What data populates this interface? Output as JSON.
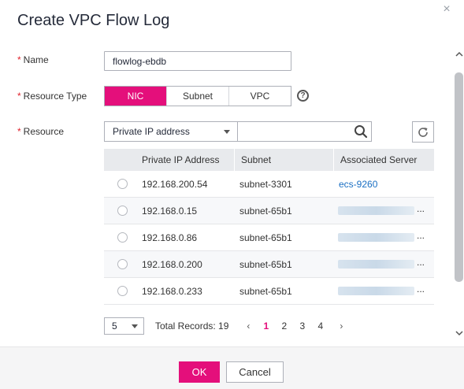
{
  "dialog": {
    "title": "Create VPC Flow Log",
    "close_symbol": "×"
  },
  "form": {
    "name_label": "Name",
    "name_value": "flowlog-ebdb",
    "resource_type_label": "Resource Type",
    "resource_types": [
      "NIC",
      "Subnet",
      "VPC"
    ],
    "resource_type_selected": "NIC",
    "resource_label": "Resource",
    "required_marker": "*",
    "help_symbol": "?"
  },
  "filter": {
    "select_value": "Private IP address",
    "search_value": ""
  },
  "table": {
    "headers": [
      "Private IP Address",
      "Subnet",
      "Associated Server"
    ],
    "rows": [
      {
        "ip": "192.168.200.54",
        "subnet": "subnet-3301",
        "server": "ecs-9260",
        "ellipsis": ""
      },
      {
        "ip": "192.168.0.15",
        "subnet": "subnet-65b1",
        "server": "",
        "ellipsis": "..."
      },
      {
        "ip": "192.168.0.86",
        "subnet": "subnet-65b1",
        "server": "",
        "ellipsis": "..."
      },
      {
        "ip": "192.168.0.200",
        "subnet": "subnet-65b1",
        "server": "",
        "ellipsis": "..."
      },
      {
        "ip": "192.168.0.233",
        "subnet": "subnet-65b1",
        "server": "",
        "ellipsis": "..."
      }
    ]
  },
  "pager": {
    "page_size": "5",
    "total_label": "Total Records: 19",
    "pages": [
      "1",
      "2",
      "3",
      "4"
    ],
    "current_page": "1",
    "prev_symbol": "‹",
    "next_symbol": "›"
  },
  "footer": {
    "ok_label": "OK",
    "cancel_label": "Cancel"
  },
  "colors": {
    "accent": "#e40f7b",
    "link": "#1a6fc3",
    "required": "#e0232d"
  },
  "icons": [
    "close-icon",
    "help-icon",
    "search-icon",
    "refresh-icon",
    "chevron-down-icon",
    "chevron-left-icon",
    "chevron-right-icon"
  ]
}
